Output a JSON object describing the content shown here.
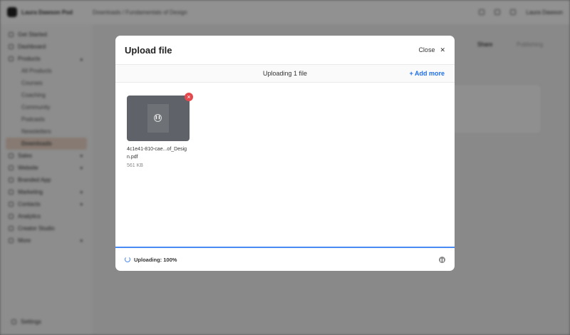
{
  "background": {
    "brand": "Laura Dawson Pod",
    "breadcrumb": [
      "Downloads",
      "/",
      "Fundamentals of Design"
    ],
    "user": "Laura Dawson",
    "sidebar": [
      {
        "label": "Get Started"
      },
      {
        "label": "Dashboard"
      },
      {
        "label": "Products",
        "chevron": "▴"
      },
      {
        "label": "All Products",
        "sub": true
      },
      {
        "label": "Courses",
        "sub": true
      },
      {
        "label": "Coaching",
        "sub": true
      },
      {
        "label": "Community",
        "sub": true
      },
      {
        "label": "Podcasts",
        "sub": true
      },
      {
        "label": "Newsletters",
        "sub": true
      },
      {
        "label": "Downloads",
        "sub": true,
        "active": true
      },
      {
        "label": "Sales",
        "chevron": "▾"
      },
      {
        "label": "Website",
        "chevron": "▾"
      },
      {
        "label": "Branded App"
      },
      {
        "label": "Marketing",
        "chevron": "▾"
      },
      {
        "label": "Contacts",
        "chevron": "▾"
      },
      {
        "label": "Analytics"
      },
      {
        "label": "Creator Studio"
      },
      {
        "label": "More",
        "chevron": "▾"
      }
    ],
    "settings": "Settings",
    "share": "Share",
    "publish": "Publishing"
  },
  "modal": {
    "title": "Upload file",
    "close_label": "Close",
    "status": "Uploading 1 file",
    "add_more": "+ Add more",
    "file": {
      "name": "4c1e41-810-cae...of_Design.pdf",
      "size": "561 KB"
    },
    "footer_status": "Uploading: 100%",
    "progress_percent": 100
  }
}
